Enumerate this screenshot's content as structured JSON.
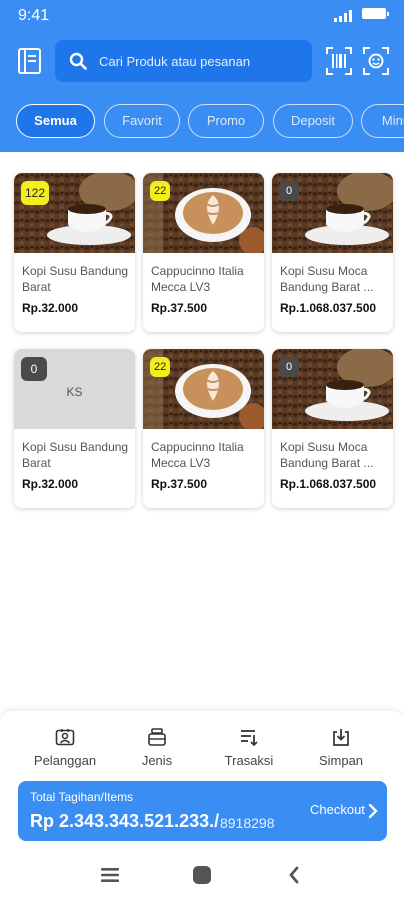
{
  "status": {
    "time": "9:41"
  },
  "search": {
    "placeholder": "Cari Produk atau pesanan"
  },
  "tabs": [
    {
      "label": "Semua",
      "active": true
    },
    {
      "label": "Favorit",
      "active": false
    },
    {
      "label": "Promo",
      "active": false
    },
    {
      "label": "Deposit",
      "active": false
    },
    {
      "label": "Minu",
      "active": false
    }
  ],
  "products": [
    {
      "badge": "122",
      "name": "Kopi Susu Bandung Barat",
      "price": "Rp.32.000",
      "image": "espresso"
    },
    {
      "badge": "22",
      "name": "Cappucinno Italia Mecca LV3",
      "price": "Rp.37.500",
      "image": "latte"
    },
    {
      "badge": "0",
      "name": "Kopi Susu Moca Bandung Barat ...",
      "price": "Rp.1.068.037.500",
      "image": "espresso"
    },
    {
      "badge": "0",
      "name": "Kopi Susu Bandung Barat",
      "price": "Rp.32.000",
      "image": "placeholder",
      "initials": "KS"
    },
    {
      "badge": "22",
      "name": "Cappucinno Italia Mecca LV3",
      "price": "Rp.37.500",
      "image": "latte"
    },
    {
      "badge": "0",
      "name": "Kopi Susu Moca Bandung Barat ...",
      "price": "Rp.1.068.037.500",
      "image": "espresso"
    }
  ],
  "actions": [
    {
      "label": "Pelanggan",
      "icon": "customer-card-icon"
    },
    {
      "label": "Jenis",
      "icon": "stack-icon"
    },
    {
      "label": "Trasaksi",
      "icon": "list-sort-icon"
    },
    {
      "label": "Simpan",
      "icon": "save-download-icon"
    }
  ],
  "checkout": {
    "title": "Total Tagihan/Items",
    "total": "Rp 2.343.343.521.233./",
    "items": "8918298",
    "button": "Checkout"
  },
  "colors": {
    "primary": "#3a8df2",
    "badge_yellow": "#f5ee1f",
    "badge_dark": "#4a4a4a"
  }
}
